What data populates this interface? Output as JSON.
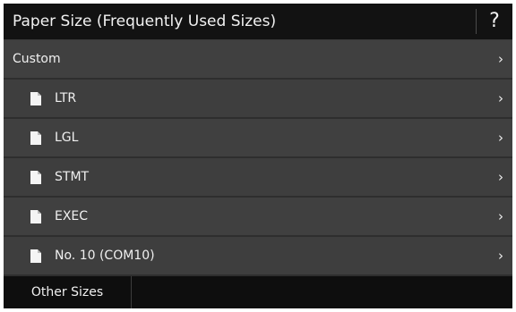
{
  "header": {
    "title": "Paper Size (Frequently Used Sizes)",
    "help_label": "?"
  },
  "list": {
    "custom": {
      "label": "Custom",
      "icon": "chevron-right-icon"
    },
    "items": [
      {
        "label": "LTR",
        "icon": "paper-sheet-icon"
      },
      {
        "label": "LGL",
        "icon": "paper-sheet-icon"
      },
      {
        "label": "STMT",
        "icon": "paper-sheet-icon"
      },
      {
        "label": "EXEC",
        "icon": "paper-sheet-icon"
      },
      {
        "label": "No. 10 (COM10)",
        "icon": "envelope-paper-icon"
      }
    ],
    "chevron": "›"
  },
  "footer": {
    "other_sizes_label": "Other Sizes"
  },
  "colors": {
    "header_bg": "#121212",
    "row_bg": "#404040",
    "footer_bg": "#0e0e0e",
    "text": "#f0f0f0"
  }
}
